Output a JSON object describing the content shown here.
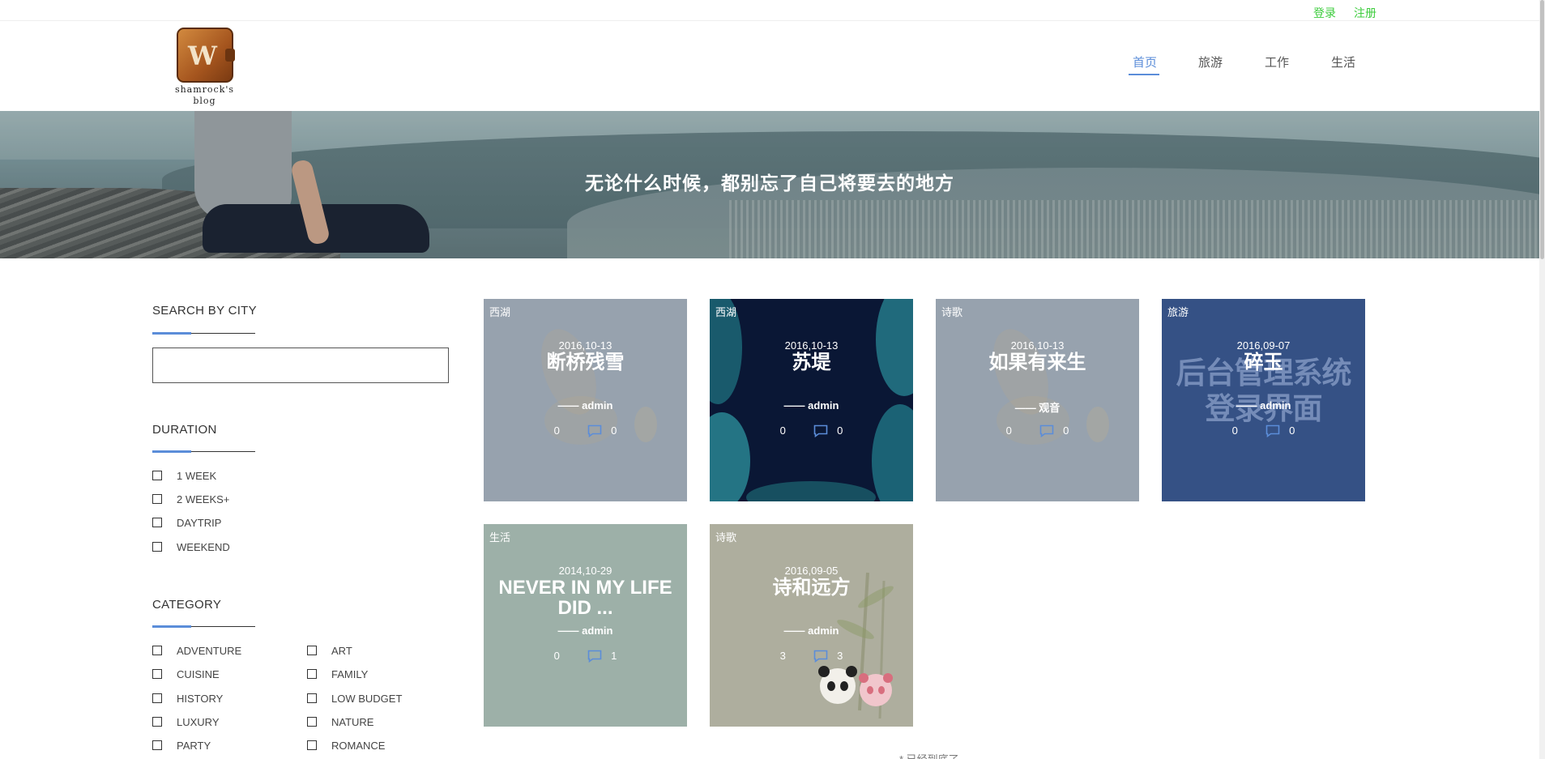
{
  "topbar": {
    "login": "登录",
    "register": "注册",
    "link_color": "#3ccc3c"
  },
  "logo": {
    "monogram": "W",
    "line1": "shamrock's",
    "line2": "blog"
  },
  "nav": [
    {
      "label": "首页",
      "active": true
    },
    {
      "label": "旅游",
      "active": false
    },
    {
      "label": "工作",
      "active": false
    },
    {
      "label": "生活",
      "active": false
    }
  ],
  "accent_color": "#5b8dd9",
  "banner": {
    "slogan": "无论什么时候，都别忘了自己将要去的地方"
  },
  "sidebar": {
    "search": {
      "title": "SEARCH BY CITY",
      "value": "",
      "placeholder": ""
    },
    "duration": {
      "title": "DURATION",
      "options": [
        "1 WEEK",
        "2 WEEKS+",
        "DAYTRIP",
        "WEEKEND"
      ]
    },
    "category": {
      "title": "CATEGORY",
      "options": [
        "ADVENTURE",
        "ART",
        "CUISINE",
        "FAMILY",
        "HISTORY",
        "LOW BUDGET",
        "LUXURY",
        "NATURE",
        "PARTY",
        "ROMANCE"
      ]
    }
  },
  "posts": [
    {
      "tag": "西湖",
      "date": "2016,10-13",
      "title": "断桥残雪",
      "author": "—— admin",
      "views": "0",
      "comments": "0",
      "bg": "#97a2ae"
    },
    {
      "tag": "西湖",
      "date": "2016,10-13",
      "title": "苏堤",
      "author": "—— admin",
      "views": "0",
      "comments": "0",
      "bg": "#0a1735"
    },
    {
      "tag": "诗歌",
      "date": "2016,10-13",
      "title": "如果有来生",
      "author": "—— 观音",
      "views": "0",
      "comments": "0",
      "bg": "#97a2ae"
    },
    {
      "tag": "旅游",
      "date": "2016,09-07",
      "title": "碎玉",
      "author": "—— admin",
      "views": "0",
      "comments": "0",
      "bg": "#355185",
      "watermark": "后台管理系统登录界面"
    },
    {
      "tag": "生活",
      "date": "2014,10-29",
      "title": "NEVER IN MY LIFE DID ...",
      "author": "—— admin",
      "views": "0",
      "comments": "1",
      "bg": "#9db0a8"
    },
    {
      "tag": "诗歌",
      "date": "2016,09-05",
      "title": "诗和远方",
      "author": "—— admin",
      "views": "3",
      "comments": "3",
      "bg": "#aeae9e"
    }
  ],
  "footer_note": "* 已经到底了"
}
